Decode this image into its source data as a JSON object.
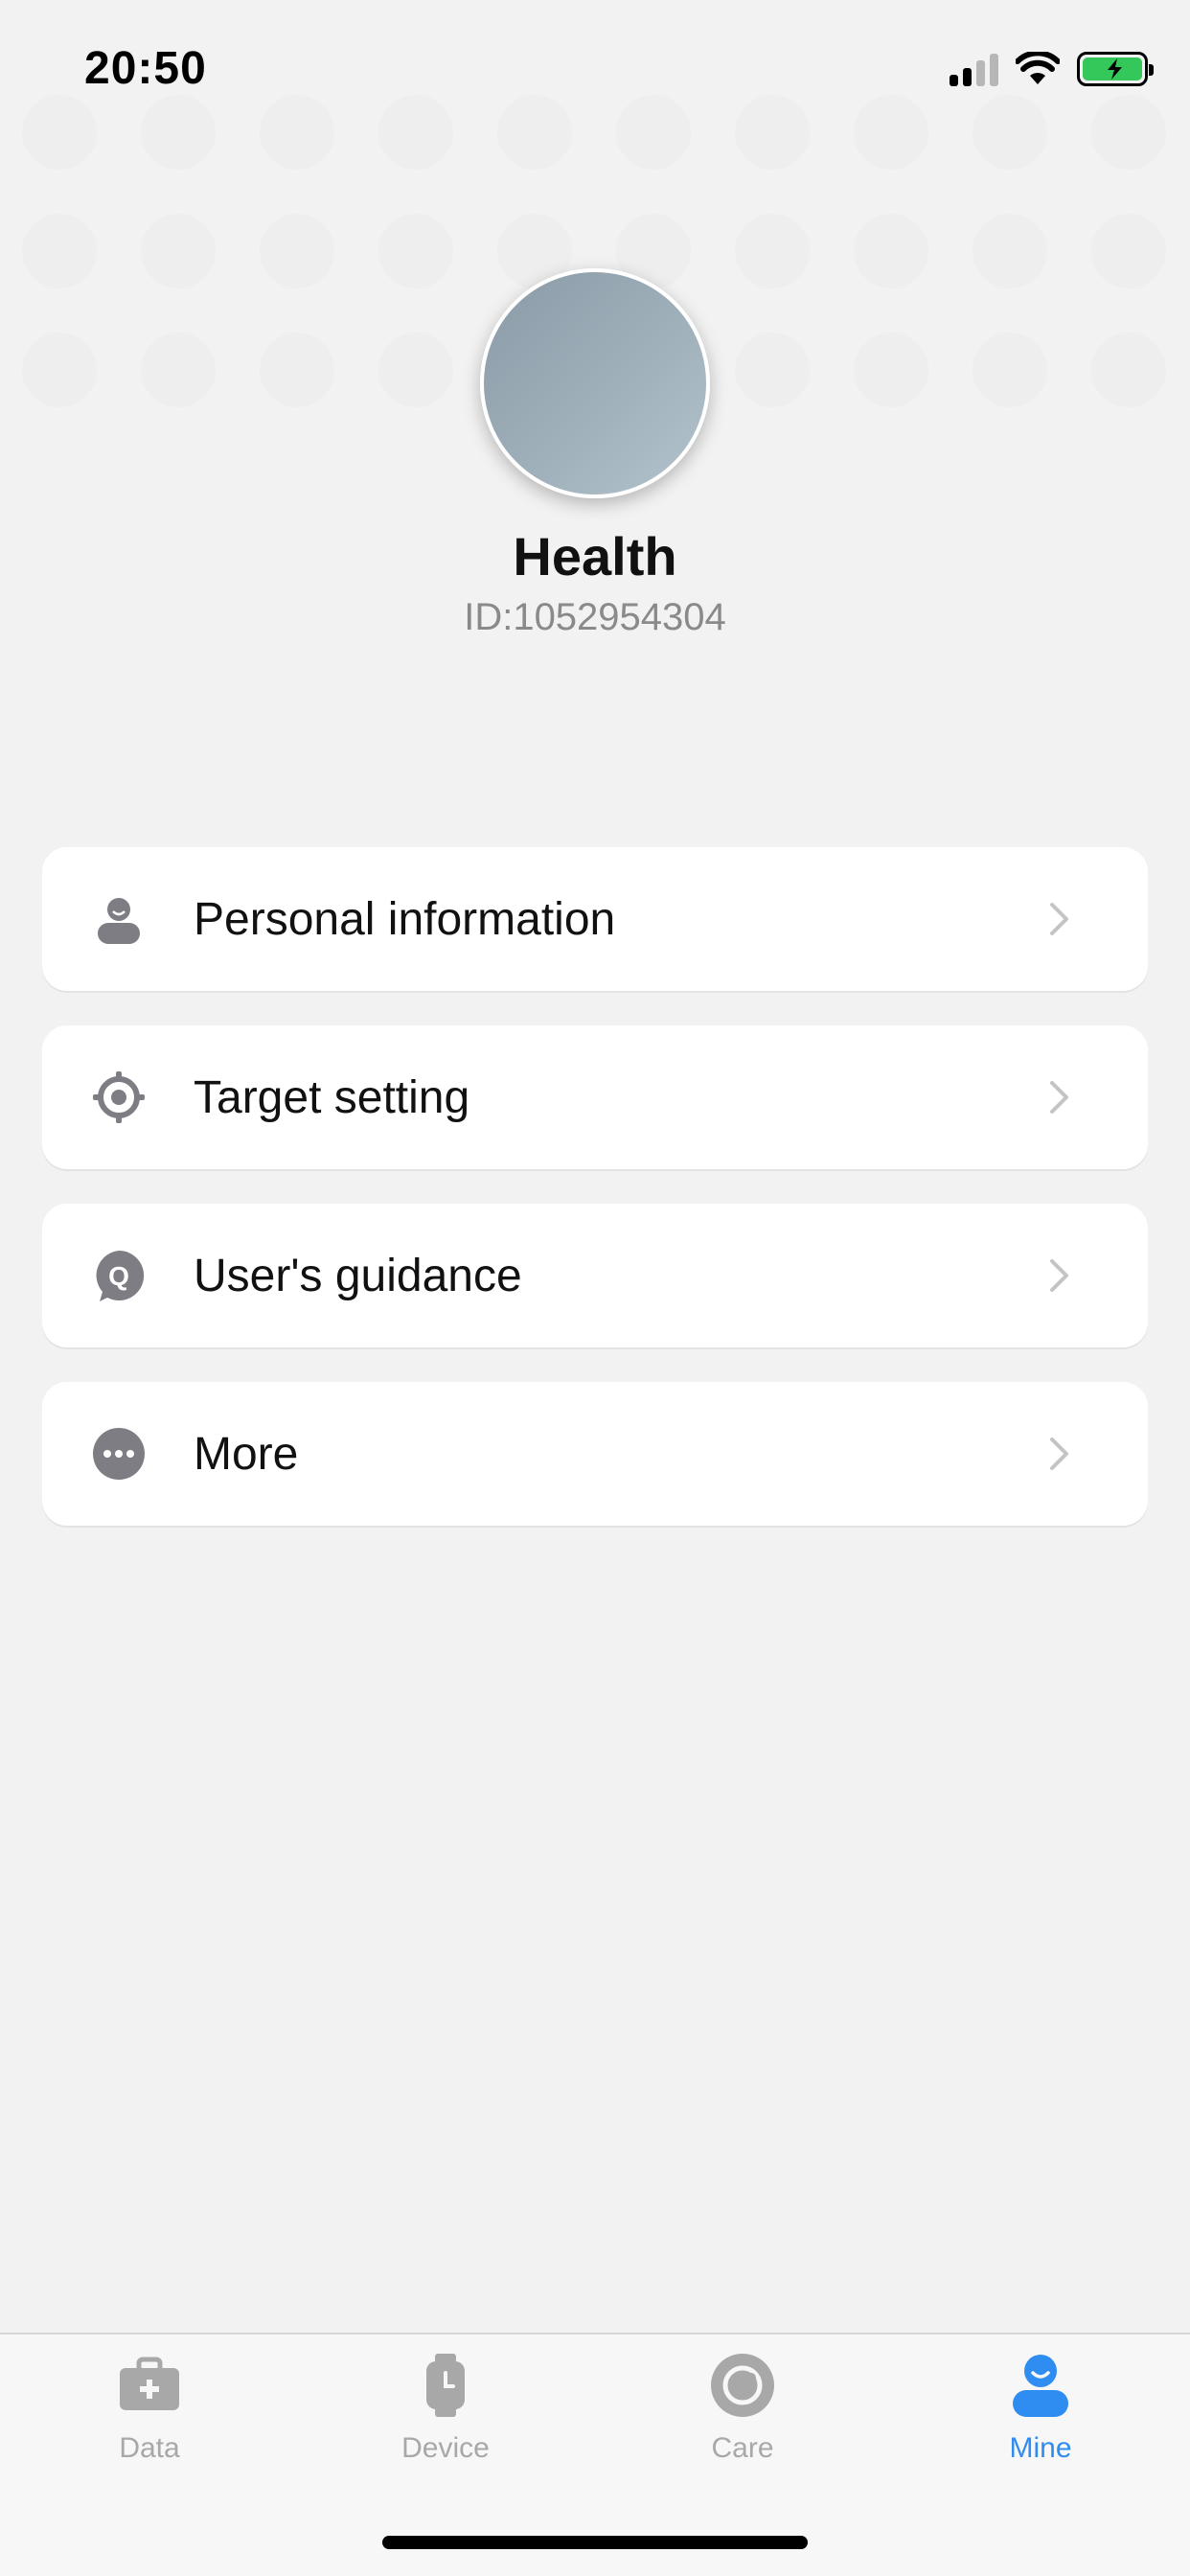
{
  "status_bar": {
    "time": "20:50",
    "battery_color": "#34c759"
  },
  "profile": {
    "name": "Health",
    "id": "ID:1052954304"
  },
  "menu": [
    {
      "label": "Personal information",
      "icon": "person-icon"
    },
    {
      "label": "Target setting",
      "icon": "target-icon"
    },
    {
      "label": "User's guidance",
      "icon": "guidance-icon"
    },
    {
      "label": "More",
      "icon": "more-icon"
    }
  ],
  "tabs": [
    {
      "label": "Data",
      "icon": "medical-kit-icon",
      "active": false
    },
    {
      "label": "Device",
      "icon": "watch-icon",
      "active": false
    },
    {
      "label": "Care",
      "icon": "care-icon",
      "active": false
    },
    {
      "label": "Mine",
      "icon": "user-icon",
      "active": true
    }
  ],
  "colors": {
    "accent": "#2f8cf1",
    "icon_gray": "#7d7d83",
    "inactive_tab": "#a8a8a8"
  }
}
